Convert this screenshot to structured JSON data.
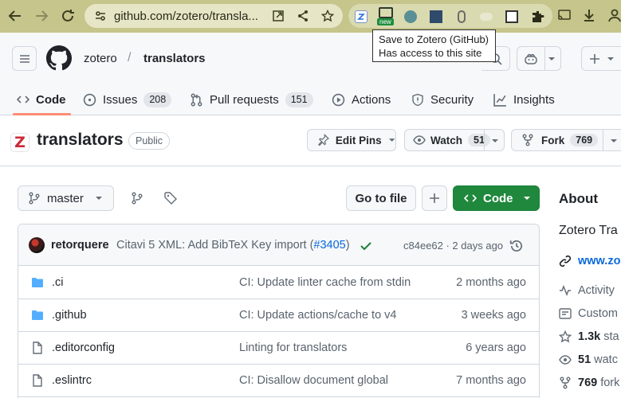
{
  "browser": {
    "url": "github.com/zotero/transla...",
    "ext_new_badge": "new",
    "tooltip_line1": "Save to Zotero (GitHub)",
    "tooltip_line2": "Has access to this site",
    "toolbar_color": "#c5c58c"
  },
  "header": {
    "owner": "zotero",
    "separator": "/",
    "repo": "translators",
    "tabs": [
      {
        "label": "Code"
      },
      {
        "label": "Issues",
        "count": "208"
      },
      {
        "label": "Pull requests",
        "count": "151"
      },
      {
        "label": "Actions"
      },
      {
        "label": "Security"
      },
      {
        "label": "Insights"
      }
    ]
  },
  "repo": {
    "name": "translators",
    "visibility": "Public",
    "logo_letter": "Z",
    "edit_pins_label": "Edit Pins",
    "watch_label": "Watch",
    "watch_count": "51",
    "fork_label": "Fork",
    "fork_count": "769"
  },
  "toolbar": {
    "branch": "master",
    "go_to_file": "Go to file",
    "code_label": "Code",
    "code_color": "#1f883d"
  },
  "commit": {
    "author": "retorquere",
    "message": "Citavi 5 XML: Add BibTeX Key import (",
    "pr": "#3405",
    "message_end": ")",
    "hash_time": "c84ee62 · 2 days ago"
  },
  "files": [
    {
      "name": ".ci",
      "type": "folder",
      "message": "CI: Update linter cache from stdin",
      "date": "2 months ago"
    },
    {
      "name": ".github",
      "type": "folder",
      "message": "CI: Update actions/cache to v4",
      "date": "3 weeks ago"
    },
    {
      "name": ".editorconfig",
      "type": "file",
      "message": "Linting for translators",
      "date": "6 years ago"
    },
    {
      "name": ".eslintrc",
      "type": "file",
      "message": "CI: Disallow document global",
      "date": "7 months ago"
    }
  ],
  "about": {
    "title": "About",
    "description": "Zotero Tra",
    "website": "www.zo",
    "activity": "Activity",
    "custom": "Custom",
    "stars_count": "1.3k",
    "stars_label": "sta",
    "watching_count": "51",
    "watching_label": "watc",
    "forks_count": "769",
    "forks_label": "fork"
  }
}
